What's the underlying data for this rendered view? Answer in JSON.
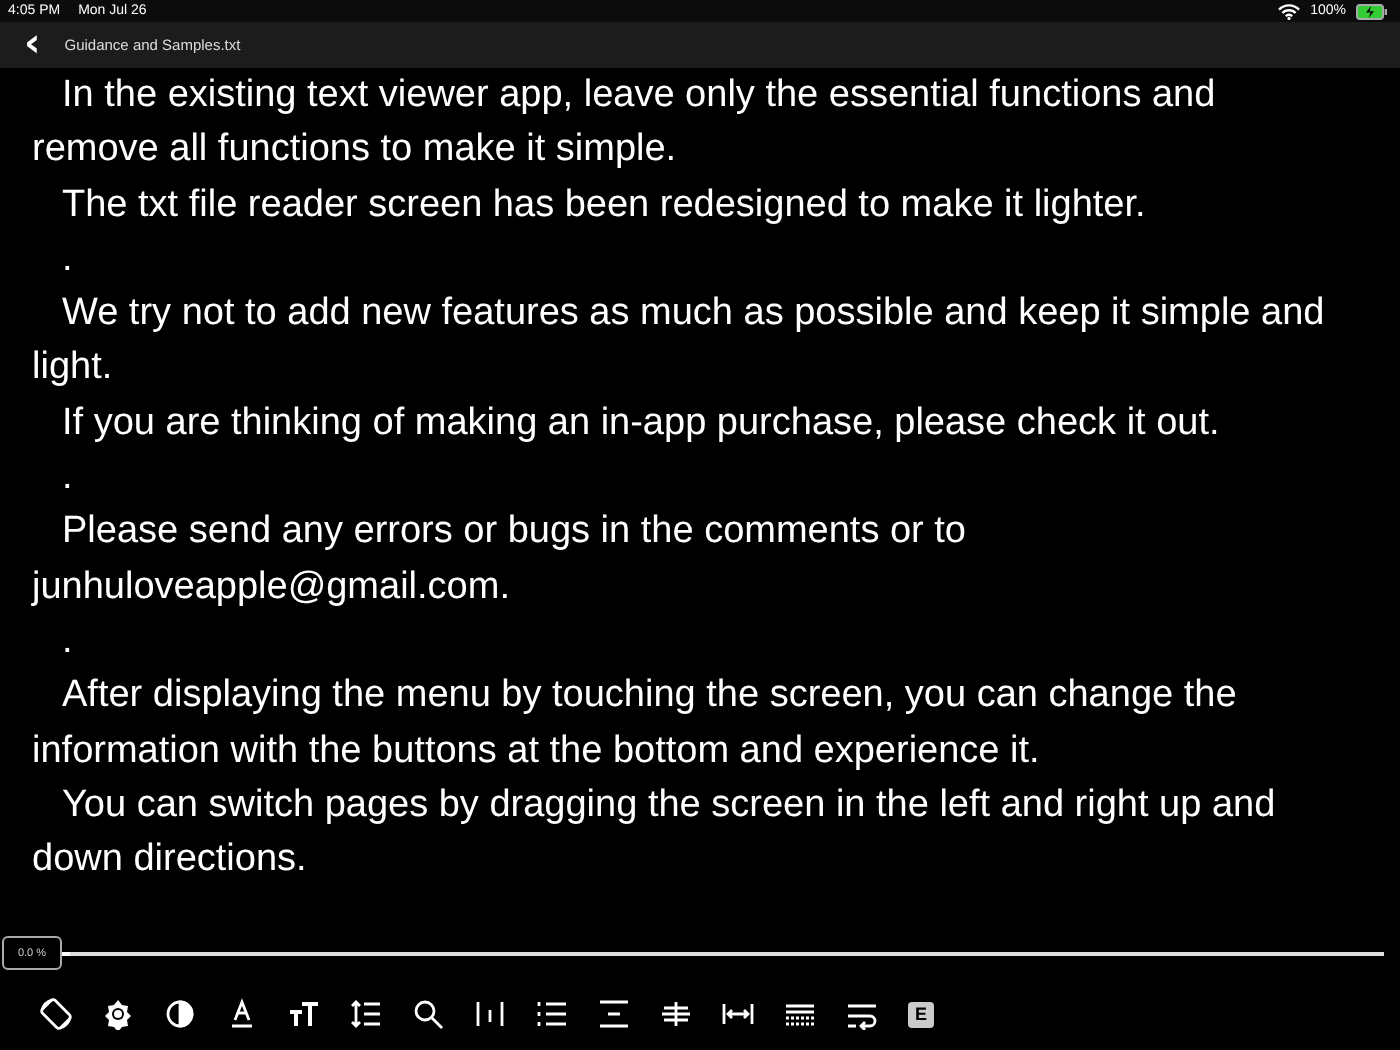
{
  "status_bar": {
    "time": "4:05 PM",
    "date": "Mon Jul 26",
    "battery": "100%"
  },
  "header": {
    "back": "‹",
    "title": "Guidance and Samples.txt"
  },
  "paragraphs": [
    "In the existing text viewer app, leave only the essential functions and remove all functions to make it simple.",
    "The txt file reader screen has been redesigned to make it lighter.",
    ".",
    "We try not to add new features as much as possible and keep it simple and light.",
    "If you are thinking of making an in-app purchase, please check it out.",
    ".",
    "Please send any errors or bugs in the comments or to junhuloveapple@gmail.com.",
    ".",
    "After displaying the menu by touching the screen, you can change the information with the buttons at the bottom and experience it.",
    "You can switch pages by dragging the screen in the left and right up and down directions."
  ],
  "progress": {
    "reading": "0.0 %",
    "level": 0
  },
  "toolbar": [
    {
      "kind": "rotate"
    },
    {
      "kind": "brightness"
    },
    {
      "kind": "contrast"
    },
    {
      "kind": "font-color"
    },
    {
      "kind": "font-size"
    },
    {
      "kind": "line-spacing"
    },
    {
      "kind": "search"
    },
    {
      "kind": "margin"
    },
    {
      "kind": "list"
    },
    {
      "kind": "align"
    },
    {
      "kind": "strike"
    },
    {
      "kind": "width"
    },
    {
      "kind": "dotted"
    },
    {
      "kind": "wrap"
    },
    {
      "kind": "letter",
      "label": "E"
    }
  ]
}
